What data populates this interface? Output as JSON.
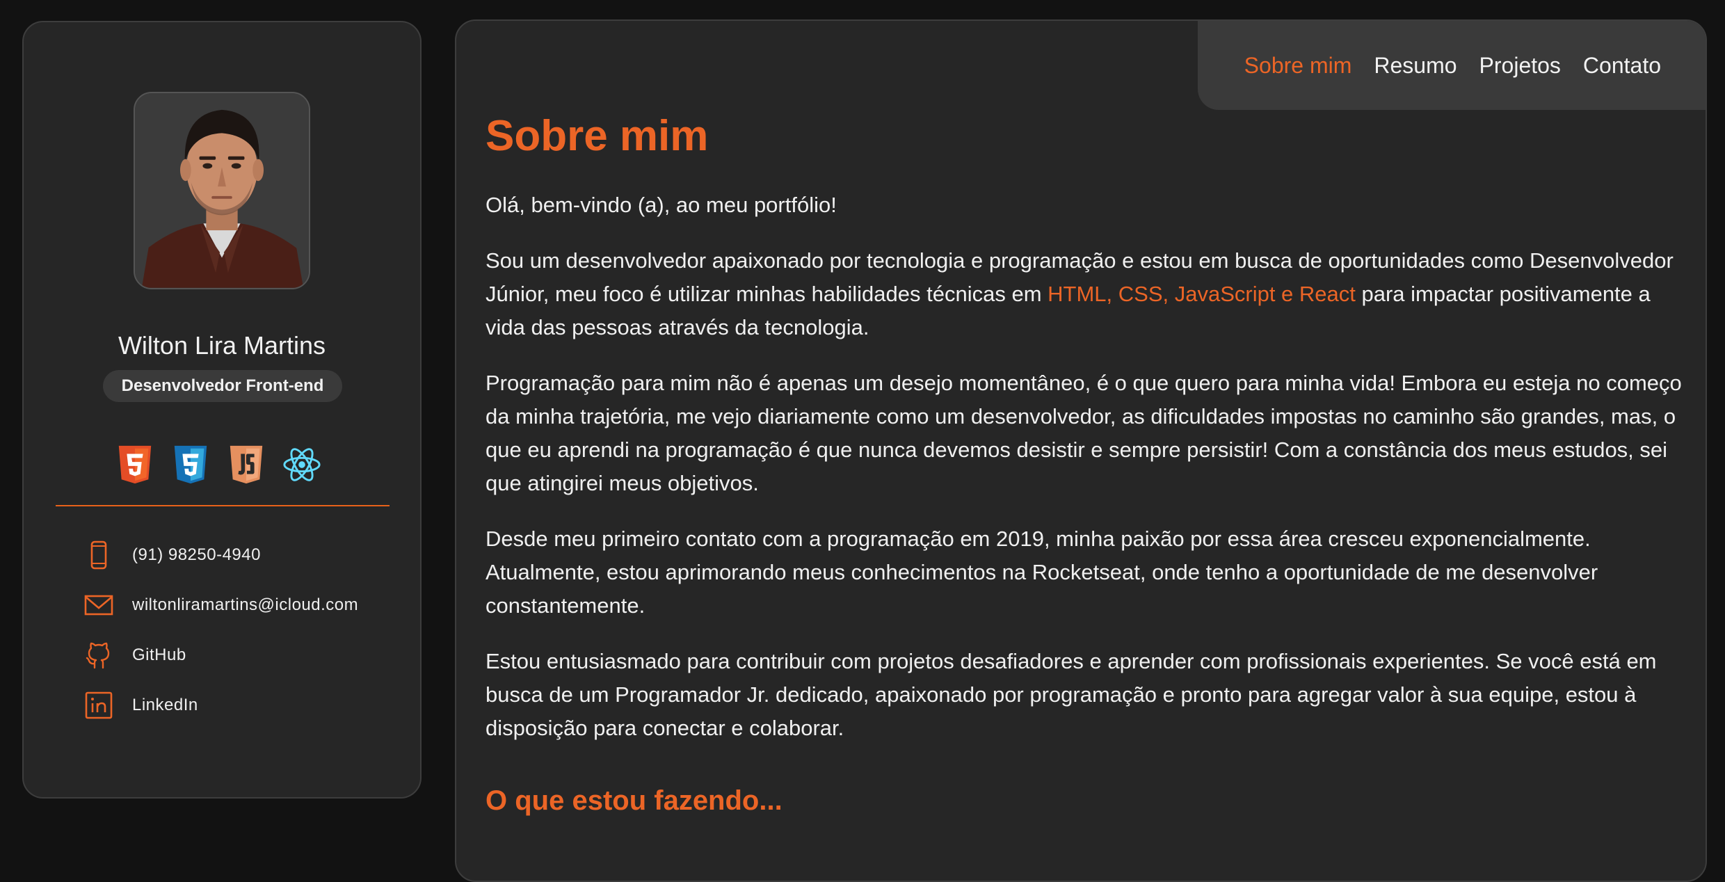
{
  "profile": {
    "name": "Wilton Lira Martins",
    "role": "Desenvolvedor Front-end",
    "tech_icons": [
      "html5-icon",
      "css3-icon",
      "javascript-icon",
      "react-icon"
    ]
  },
  "contacts": [
    {
      "icon": "phone-icon",
      "label": "(91) 98250-4940"
    },
    {
      "icon": "mail-icon",
      "label": "wiltonliramartins@icloud.com"
    },
    {
      "icon": "github-icon",
      "label": "GitHub"
    },
    {
      "icon": "linkedin-icon",
      "label": "LinkedIn"
    }
  ],
  "nav": {
    "items": [
      "Sobre mim",
      "Resumo",
      "Projetos",
      "Contato"
    ],
    "active": "Sobre mim"
  },
  "about": {
    "title": "Sobre mim",
    "greeting": "Olá, bem-vindo (a), ao meu portfólio!",
    "p1_before": "Sou um desenvolvedor apaixonado por tecnologia e programação e estou em busca de oportunidades como Desenvolvedor Júnior, meu foco é utilizar minhas habilidades técnicas em ",
    "p1_highlight": "HTML, CSS, JavaScript e React",
    "p1_after": " para impactar positivamente a vida das pessoas através da tecnologia.",
    "p2": "Programação para mim não é apenas um desejo momentâneo, é o que quero para minha vida! Embora eu esteja no começo da minha trajetória, me vejo diariamente como um desenvolvedor, as dificuldades impostas no caminho são grandes, mas, o que eu aprendi na programação é que nunca devemos desistir e sempre persistir! Com a constância dos meus estudos, sei que atingirei meus objetivos.",
    "p3": "Desde meu primeiro contato com a programação em 2019, minha paixão por essa área cresceu exponencialmente. Atualmente, estou aprimorando meus conhecimentos na Rocketseat, onde tenho a oportunidade de me desenvolver constantemente.",
    "p4": "Estou entusiasmado para contribuir com projetos desafiadores e aprender com profissionais experientes. Se você está em busca de um Programador Jr. dedicado, apaixonado por programação e pronto para agregar valor à sua equipe, estou à disposição para conectar e colaborar.",
    "subtitle": "O que estou fazendo..."
  },
  "colors": {
    "accent": "#ec6526",
    "background": "#121212",
    "panel": "#262626",
    "nav_bg": "#3a3a3a"
  }
}
